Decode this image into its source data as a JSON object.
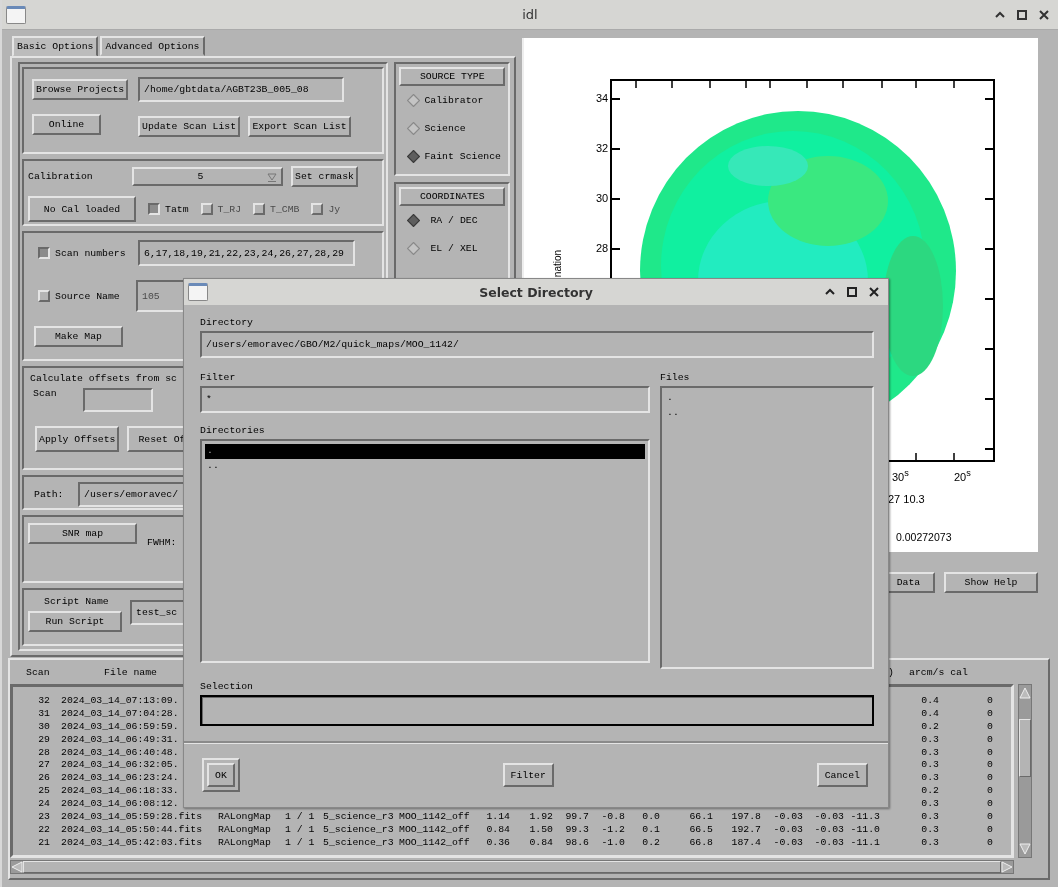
{
  "window": {
    "title": "idl"
  },
  "tabs": [
    {
      "label": "Basic Options",
      "selected": true
    },
    {
      "label": "Advanced Options",
      "selected": false
    }
  ],
  "project": {
    "browse_button": "Browse Projects",
    "path": "/home/gbtdata/AGBT23B_005_08",
    "online_button": "Online",
    "update_button": "Update Scan List",
    "export_button": "Export Scan List"
  },
  "calibration": {
    "label": "Calibration",
    "value": "5",
    "crmask_button": "Set crmask",
    "cal_button": "No Cal loaded",
    "units": [
      {
        "label": "Tatm",
        "checked": true,
        "disabled": false
      },
      {
        "label": "T_RJ",
        "checked": false,
        "disabled": true
      },
      {
        "label": "T_CMB",
        "checked": false,
        "disabled": true
      },
      {
        "label": "Jy",
        "checked": false,
        "disabled": true
      }
    ]
  },
  "selection": {
    "scan_numbers": {
      "label": "Scan numbers",
      "checked": true,
      "value": "6,17,18,19,21,22,23,24,26,27,28,29"
    },
    "source_name": {
      "label": "Source Name",
      "checked": false,
      "value": "105"
    },
    "make_map_button": "Make Map"
  },
  "offsets": {
    "label": "Calculate offsets from sc",
    "scan_label": "Scan",
    "apply_button": "Apply Offsets",
    "reset_button": "Reset Of"
  },
  "path": {
    "label": "Path:",
    "value": "/users/emoravec/"
  },
  "snr": {
    "button": "SNR map",
    "fwhm_label": "FWHM:"
  },
  "script": {
    "label": "Script Name",
    "value": "test_sc",
    "run_button": "Run Script"
  },
  "source_type": {
    "title": "SOURCE TYPE",
    "options": [
      {
        "label": "Calibrator",
        "selected": false
      },
      {
        "label": "Science",
        "selected": false
      },
      {
        "label": "Faint Science",
        "selected": true
      }
    ]
  },
  "coordinates": {
    "title": "COORDINATES",
    "options": [
      {
        "label": "RA / DEC",
        "selected": true
      },
      {
        "label": "EL / XEL",
        "selected": false
      }
    ]
  },
  "plot": {
    "y_ticks": [
      "34",
      "32",
      "30",
      "28"
    ],
    "x_ticks": [
      "30$^{s}$",
      "20$^{s}$"
    ],
    "ylabel": "nation",
    "coordinate_readout": "27 10.3",
    "value_readout": "0.00272073"
  },
  "plot_buttons": [
    "Data",
    "Show Help"
  ],
  "table": {
    "columns": [
      "Scan",
      "File name",
      ")",
      "arcm/s cal"
    ],
    "rows": [
      {
        "scan": "32",
        "file": "2024_03_14_07:13:09.",
        "arcm_s": "0.4",
        "cal": "0"
      },
      {
        "scan": "31",
        "file": "2024_03_14_07:04:28.",
        "arcm_s": "0.4",
        "cal": "0"
      },
      {
        "scan": "30",
        "file": "2024_03_14_06:59:59.",
        "arcm_s": "0.2",
        "cal": "0"
      },
      {
        "scan": "29",
        "file": "2024_03_14_06:49:31.",
        "arcm_s": "0.3",
        "cal": "0"
      },
      {
        "scan": "28",
        "file": "2024_03_14_06:40:48.",
        "arcm_s": "0.3",
        "cal": "0"
      },
      {
        "scan": "27",
        "file": "2024_03_14_06:32:05.",
        "arcm_s": "0.3",
        "cal": "0"
      },
      {
        "scan": "26",
        "file": "2024_03_14_06:23:24.",
        "arcm_s": "0.3",
        "cal": "0"
      },
      {
        "scan": "25",
        "file": "2024_03_14_06:18:33.",
        "arcm_s": "0.2",
        "cal": "0"
      },
      {
        "scan": "24",
        "file": "2024_03_14_06:08:12.",
        "arcm_s": "0.3",
        "cal": "0"
      },
      {
        "scan": "23",
        "file": "2024_03_14_05:59:28.fits",
        "details": [
          "RALongMap",
          "1 / 1",
          "5_science_r3",
          "MOO_1142_off",
          "1.14",
          "1.92",
          "99.7",
          "-0.8",
          "0.0",
          "66.1",
          "197.8",
          "-0.03",
          "-0.03",
          "-11.3"
        ],
        "arcm_s": "0.3",
        "cal": "0"
      },
      {
        "scan": "22",
        "file": "2024_03_14_05:50:44.fits",
        "details": [
          "RALongMap",
          "1 / 1",
          "5_science_r3",
          "MOO_1142_off",
          "0.84",
          "1.50",
          "99.3",
          "-1.2",
          "0.1",
          "66.5",
          "192.7",
          "-0.03",
          "-0.03",
          "-11.0"
        ],
        "arcm_s": "0.3",
        "cal": "0"
      },
      {
        "scan": "21",
        "file": "2024_03_14_05:42:03.fits",
        "details": [
          "RALongMap",
          "1 / 1",
          "5_science_r3",
          "MOO_1142_off",
          "0.36",
          "0.84",
          "98.6",
          "-1.0",
          "0.2",
          "66.8",
          "187.4",
          "-0.03",
          "-0.03",
          "-11.1"
        ],
        "arcm_s": "0.3",
        "cal": "0"
      }
    ]
  },
  "dialog": {
    "title": "Select Directory",
    "directory_label": "Directory",
    "directory": "/users/emoravec/GBO/M2/quick_maps/MOO_1142/",
    "filter_label": "Filter",
    "filter": "*",
    "files_label": "Files",
    "files": [
      ".",
      ".."
    ],
    "directories_label": "Directories",
    "directories": [
      {
        "name": ".",
        "selected": true
      },
      {
        "name": "..",
        "selected": false
      }
    ],
    "selection_label": "Selection",
    "ok_button": "OK",
    "filter_button": "Filter",
    "cancel_button": "Cancel"
  }
}
